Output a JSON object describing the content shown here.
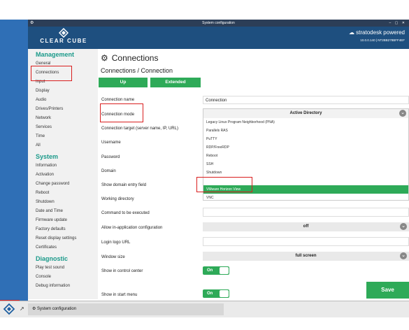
{
  "window": {
    "title": "System configuration",
    "controls": "– ▢ ✕"
  },
  "brand": {
    "name": "CLEAR CUBE",
    "partner": "stratodesk powered",
    "version": "10.0.0.140 | NT2BB278BFF4EF"
  },
  "sidebar": {
    "sections": [
      {
        "title": "Management",
        "items": [
          "General",
          "Connections",
          "Input",
          "Display",
          "Audio",
          "Drives/Printers",
          "Network",
          "Services",
          "Time",
          "All"
        ]
      },
      {
        "title": "System",
        "items": [
          "Information",
          "Activation",
          "Change password",
          "Reboot",
          "Shutdown",
          "Date and Time",
          "Firmware update",
          "Factory defaults",
          "Reset display settings",
          "Certificates"
        ]
      },
      {
        "title": "Diagnostic",
        "items": [
          "Play test sound",
          "Console",
          "Debug information"
        ]
      }
    ]
  },
  "main": {
    "title": "Connections",
    "subtitle": "Connections / Connection",
    "buttons": {
      "up": "Up",
      "extended": "Extended",
      "save": "Save"
    },
    "labels": {
      "name": "Connection name",
      "mode": "Connection mode",
      "target": "Connection target (server name, IP, URL)",
      "username": "Username",
      "password": "Password",
      "domain": "Domain",
      "show_domain": "Show domain entry field",
      "workdir": "Working directory",
      "command": "Command to be executed",
      "inapp": "Allow in-application configuration",
      "logo": "Login logo URL",
      "winsize": "Window size",
      "control": "Show in control center",
      "startmenu": "Show in start menu"
    },
    "values": {
      "name": "Connection",
      "mode": "Active Directory",
      "inapp": "off",
      "winsize": "full screen",
      "control": "On",
      "startmenu": "On"
    },
    "dropdown_options": [
      "Legacy Linux Program Neighborhood (PNA)",
      "Parallels RAS",
      "PuTTY",
      "RDP/FreeRDP",
      "Reboot",
      "SSH",
      "Shutdown",
      "",
      "VMware Horizon View",
      "VNC"
    ],
    "dropdown_selected": "VMware Horizon View"
  },
  "taskbar": {
    "app": "System configuration"
  },
  "colors": {
    "accent": "#2eaa58",
    "header": "#1e4f7f",
    "section": "#1b9a8a",
    "highlight": "#d91e1e"
  }
}
